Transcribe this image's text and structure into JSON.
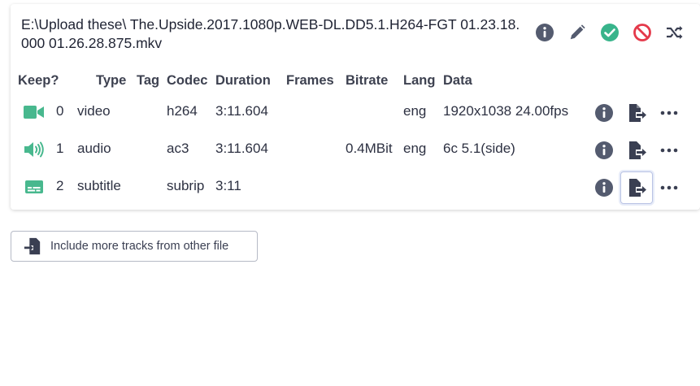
{
  "file": {
    "title": "E:\\Upload these\\ The.Upside.2017.1080p.WEB-DL.DD5.1.H264-FGT 01.23.18.000 01.26.28.875.mkv"
  },
  "toolbar": {
    "icons": [
      "info-icon",
      "pencil-icon",
      "check-circle-icon",
      "block-icon",
      "shuffle-icon"
    ],
    "colors": {
      "info": "#545b6f",
      "pencil": "#545b6f",
      "check": "#38b48b",
      "block": "#e4394a",
      "shuffle": "#3a3f52"
    }
  },
  "columns": {
    "keep": "Keep?",
    "index": "",
    "type": "Type",
    "tag": "Tag",
    "codec": "Codec",
    "duration": "Duration",
    "frames": "Frames",
    "bitrate": "Bitrate",
    "lang": "Lang",
    "data": "Data"
  },
  "tracks": [
    {
      "index": "0",
      "type": "video",
      "tag": "",
      "codec": "h264",
      "duration": "3:11.604",
      "frames": "",
      "bitrate": "",
      "lang": "eng",
      "data": "1920x1038 24.00fps",
      "keep_icon": "video-camera-icon"
    },
    {
      "index": "1",
      "type": "audio",
      "tag": "",
      "codec": "ac3",
      "duration": "3:11.604",
      "frames": "",
      "bitrate": "0.4MBit",
      "lang": "eng",
      "data": "6c 5.1(side)",
      "keep_icon": "speaker-icon"
    },
    {
      "index": "2",
      "type": "subtitle",
      "tag": "",
      "codec": "subrip",
      "duration": "3:11",
      "frames": "",
      "bitrate": "",
      "lang": "",
      "data": "",
      "keep_icon": "subtitles-icon"
    }
  ],
  "keep_color": "#48b88e",
  "include_button": {
    "label": "Include more tracks from other file"
  }
}
